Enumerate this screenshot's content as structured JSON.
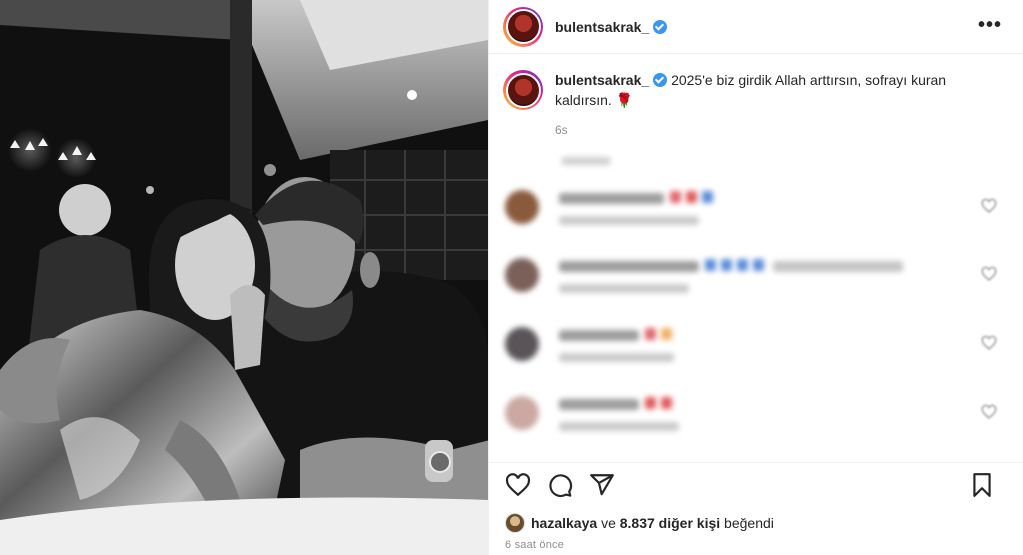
{
  "header": {
    "username": "bulentsakrak_",
    "more_label": "•••"
  },
  "caption": {
    "username": "bulentsakrak_",
    "text": "2025'e biz girdik Allah arttırsın, sofrayı kuran kaldırsın. 🌹",
    "time": "6s"
  },
  "comments": [
    {
      "avatar_color": "#8a5a3c",
      "emojis": [
        "#e0646c",
        "#e05a5a",
        "#5b8bd9"
      ]
    },
    {
      "avatar_color": "#7a6058",
      "emojis": [
        "#5b8bd9",
        "#5b8bd9",
        "#5b8bd9",
        "#5b8bd9"
      ]
    },
    {
      "avatar_color": "#5a5458",
      "emojis": [
        "#e0646c",
        "#f0b060"
      ]
    },
    {
      "avatar_color": "#cba8a2",
      "emojis": [
        "#e05a5a",
        "#e05a5a"
      ]
    }
  ],
  "likes": {
    "first_liker": "hazalkaya",
    "connector": "ve",
    "others": "8.837 diğer kişi",
    "suffix": "beğendi"
  },
  "time_ago": "6 saat önce",
  "icons": [
    "heart-icon",
    "comment-icon",
    "share-icon",
    "bookmark-icon",
    "verified-icon",
    "more-options-icon"
  ],
  "colors": {
    "verified": "#3897f0",
    "text": "#262626",
    "muted": "#8e8e8e"
  }
}
